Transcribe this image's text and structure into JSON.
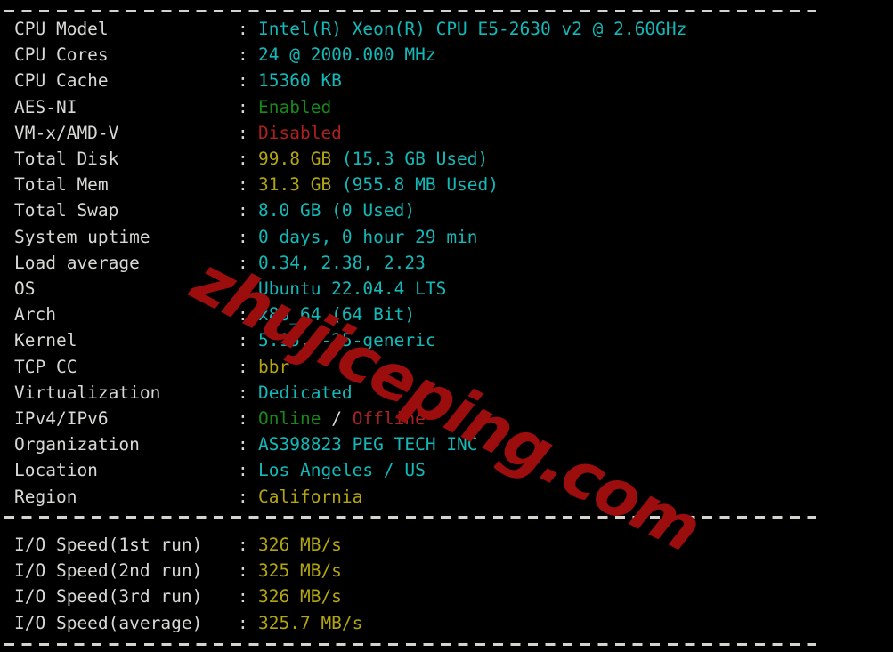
{
  "terminal": {
    "background_color": "#000000",
    "label_color": "#d8d8d4",
    "accent_cyan": "#13b9b9",
    "accent_yellow": "#b3a50f",
    "accent_green": "#17891b",
    "accent_red": "#ab2121",
    "separator_char": "-",
    "colon": ":"
  },
  "watermark": {
    "text": "zhujiceping.com",
    "color": "#9c0d0d"
  },
  "system_info": {
    "rows": [
      {
        "label": "CPU Model",
        "value": "Intel(R) Xeon(R) CPU E5-2630 v2 @ 2.60GHz",
        "color": "cyan"
      },
      {
        "label": "CPU Cores",
        "value": "24 @ 2000.000 MHz",
        "color": "cyan"
      },
      {
        "label": "CPU Cache",
        "value": "15360 KB",
        "color": "cyan"
      },
      {
        "label": "AES-NI",
        "value": "Enabled",
        "color": "green"
      },
      {
        "label": "VM-x/AMD-V",
        "value": "Disabled",
        "color": "red"
      },
      {
        "label": "Total Disk",
        "value": "99.8 GB (15.3 GB Used)",
        "color": "split-yellow-cyan",
        "value_primary": "99.8 GB ",
        "value_secondary": "(15.3 GB Used)"
      },
      {
        "label": "Total Mem",
        "value": "31.3 GB (955.8 MB Used)",
        "color": "split-yellow-cyan",
        "value_primary": "31.3 GB ",
        "value_secondary": "(955.8 MB Used)"
      },
      {
        "label": "Total Swap",
        "value": "8.0 GB (0 Used)",
        "color": "cyan"
      },
      {
        "label": "System uptime",
        "value": "0 days, 0 hour 29 min",
        "color": "cyan"
      },
      {
        "label": "Load average",
        "value": "0.34, 2.38, 2.23",
        "color": "cyan"
      },
      {
        "label": "OS",
        "value": "Ubuntu 22.04.4 LTS",
        "color": "cyan"
      },
      {
        "label": "Arch",
        "value": "x86_64 (64 Bit)",
        "color": "cyan"
      },
      {
        "label": "Kernel",
        "value": "5.15.0-25-generic",
        "color": "cyan"
      },
      {
        "label": "TCP CC",
        "value": "bbr",
        "color": "yellow"
      },
      {
        "label": "Virtualization",
        "value": "Dedicated",
        "color": "cyan"
      },
      {
        "label": "IPv4/IPv6",
        "value": "Online / Offline",
        "color": "split-green-red",
        "value_primary": "Online",
        "value_mid": " / ",
        "value_secondary": "Offline"
      },
      {
        "label": "Organization",
        "value": "AS398823 PEG TECH INC",
        "color": "cyan"
      },
      {
        "label": "Location",
        "value": "Los Angeles / US",
        "color": "cyan"
      },
      {
        "label": "Region",
        "value": "California",
        "color": "yellow"
      }
    ]
  },
  "io_speed": {
    "rows": [
      {
        "label": "I/O Speed(1st run)",
        "value": "326 MB/s",
        "color": "yellow"
      },
      {
        "label": "I/O Speed(2nd run)",
        "value": "325 MB/s",
        "color": "yellow"
      },
      {
        "label": "I/O Speed(3rd run)",
        "value": "326 MB/s",
        "color": "yellow"
      },
      {
        "label": "I/O Speed(average)",
        "value": "325.7 MB/s",
        "color": "yellow"
      }
    ]
  }
}
